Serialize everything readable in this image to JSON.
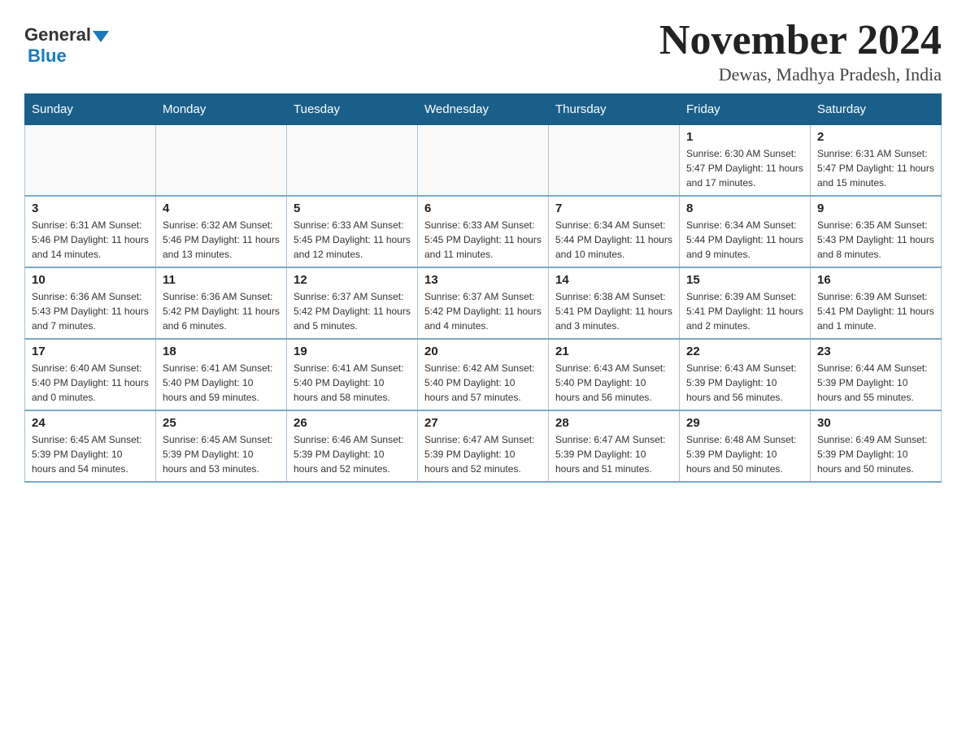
{
  "logo": {
    "text_general": "General",
    "text_blue": "Blue"
  },
  "title": "November 2024",
  "subtitle": "Dewas, Madhya Pradesh, India",
  "days_of_week": [
    "Sunday",
    "Monday",
    "Tuesday",
    "Wednesday",
    "Thursday",
    "Friday",
    "Saturday"
  ],
  "weeks": [
    [
      {
        "day": "",
        "info": ""
      },
      {
        "day": "",
        "info": ""
      },
      {
        "day": "",
        "info": ""
      },
      {
        "day": "",
        "info": ""
      },
      {
        "day": "",
        "info": ""
      },
      {
        "day": "1",
        "info": "Sunrise: 6:30 AM\nSunset: 5:47 PM\nDaylight: 11 hours and 17 minutes."
      },
      {
        "day": "2",
        "info": "Sunrise: 6:31 AM\nSunset: 5:47 PM\nDaylight: 11 hours and 15 minutes."
      }
    ],
    [
      {
        "day": "3",
        "info": "Sunrise: 6:31 AM\nSunset: 5:46 PM\nDaylight: 11 hours and 14 minutes."
      },
      {
        "day": "4",
        "info": "Sunrise: 6:32 AM\nSunset: 5:46 PM\nDaylight: 11 hours and 13 minutes."
      },
      {
        "day": "5",
        "info": "Sunrise: 6:33 AM\nSunset: 5:45 PM\nDaylight: 11 hours and 12 minutes."
      },
      {
        "day": "6",
        "info": "Sunrise: 6:33 AM\nSunset: 5:45 PM\nDaylight: 11 hours and 11 minutes."
      },
      {
        "day": "7",
        "info": "Sunrise: 6:34 AM\nSunset: 5:44 PM\nDaylight: 11 hours and 10 minutes."
      },
      {
        "day": "8",
        "info": "Sunrise: 6:34 AM\nSunset: 5:44 PM\nDaylight: 11 hours and 9 minutes."
      },
      {
        "day": "9",
        "info": "Sunrise: 6:35 AM\nSunset: 5:43 PM\nDaylight: 11 hours and 8 minutes."
      }
    ],
    [
      {
        "day": "10",
        "info": "Sunrise: 6:36 AM\nSunset: 5:43 PM\nDaylight: 11 hours and 7 minutes."
      },
      {
        "day": "11",
        "info": "Sunrise: 6:36 AM\nSunset: 5:42 PM\nDaylight: 11 hours and 6 minutes."
      },
      {
        "day": "12",
        "info": "Sunrise: 6:37 AM\nSunset: 5:42 PM\nDaylight: 11 hours and 5 minutes."
      },
      {
        "day": "13",
        "info": "Sunrise: 6:37 AM\nSunset: 5:42 PM\nDaylight: 11 hours and 4 minutes."
      },
      {
        "day": "14",
        "info": "Sunrise: 6:38 AM\nSunset: 5:41 PM\nDaylight: 11 hours and 3 minutes."
      },
      {
        "day": "15",
        "info": "Sunrise: 6:39 AM\nSunset: 5:41 PM\nDaylight: 11 hours and 2 minutes."
      },
      {
        "day": "16",
        "info": "Sunrise: 6:39 AM\nSunset: 5:41 PM\nDaylight: 11 hours and 1 minute."
      }
    ],
    [
      {
        "day": "17",
        "info": "Sunrise: 6:40 AM\nSunset: 5:40 PM\nDaylight: 11 hours and 0 minutes."
      },
      {
        "day": "18",
        "info": "Sunrise: 6:41 AM\nSunset: 5:40 PM\nDaylight: 10 hours and 59 minutes."
      },
      {
        "day": "19",
        "info": "Sunrise: 6:41 AM\nSunset: 5:40 PM\nDaylight: 10 hours and 58 minutes."
      },
      {
        "day": "20",
        "info": "Sunrise: 6:42 AM\nSunset: 5:40 PM\nDaylight: 10 hours and 57 minutes."
      },
      {
        "day": "21",
        "info": "Sunrise: 6:43 AM\nSunset: 5:40 PM\nDaylight: 10 hours and 56 minutes."
      },
      {
        "day": "22",
        "info": "Sunrise: 6:43 AM\nSunset: 5:39 PM\nDaylight: 10 hours and 56 minutes."
      },
      {
        "day": "23",
        "info": "Sunrise: 6:44 AM\nSunset: 5:39 PM\nDaylight: 10 hours and 55 minutes."
      }
    ],
    [
      {
        "day": "24",
        "info": "Sunrise: 6:45 AM\nSunset: 5:39 PM\nDaylight: 10 hours and 54 minutes."
      },
      {
        "day": "25",
        "info": "Sunrise: 6:45 AM\nSunset: 5:39 PM\nDaylight: 10 hours and 53 minutes."
      },
      {
        "day": "26",
        "info": "Sunrise: 6:46 AM\nSunset: 5:39 PM\nDaylight: 10 hours and 52 minutes."
      },
      {
        "day": "27",
        "info": "Sunrise: 6:47 AM\nSunset: 5:39 PM\nDaylight: 10 hours and 52 minutes."
      },
      {
        "day": "28",
        "info": "Sunrise: 6:47 AM\nSunset: 5:39 PM\nDaylight: 10 hours and 51 minutes."
      },
      {
        "day": "29",
        "info": "Sunrise: 6:48 AM\nSunset: 5:39 PM\nDaylight: 10 hours and 50 minutes."
      },
      {
        "day": "30",
        "info": "Sunrise: 6:49 AM\nSunset: 5:39 PM\nDaylight: 10 hours and 50 minutes."
      }
    ]
  ]
}
